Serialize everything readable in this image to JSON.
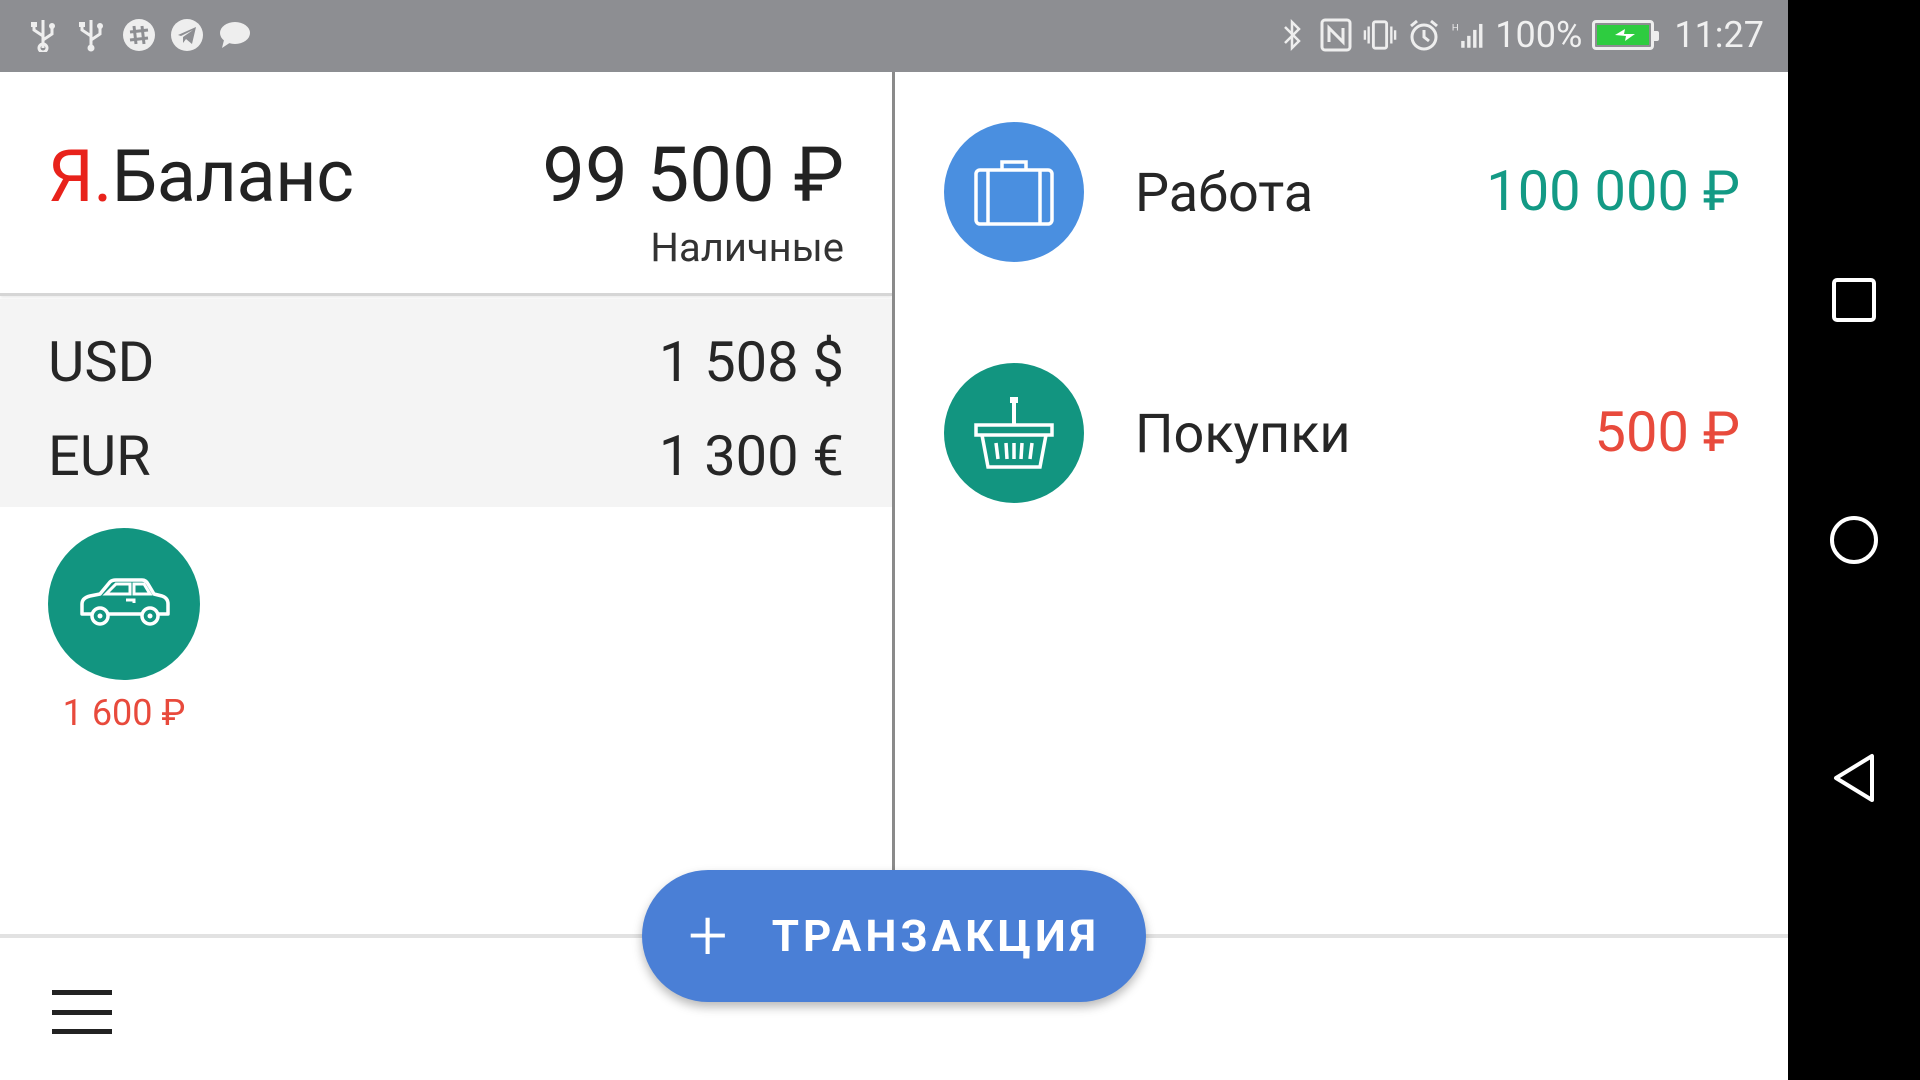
{
  "status_bar": {
    "left_icons": [
      "usb-icon",
      "usb-icon",
      "slack-icon",
      "telegram-icon",
      "chat-icon"
    ],
    "right_icons": [
      "bluetooth-icon",
      "nfc-icon",
      "vibrate-icon",
      "alarm-icon",
      "signal-icon"
    ],
    "battery_percent": "100%",
    "battery_level": 1.0,
    "time": "11:27"
  },
  "header": {
    "app_name_prefix": "Я.",
    "app_name_rest": "Баланс",
    "total": "99 500 ₽",
    "total_label": "Наличные"
  },
  "currencies": [
    {
      "code": "USD",
      "amount": "1 508 $"
    },
    {
      "code": "EUR",
      "amount": "1 300 €"
    }
  ],
  "accounts": [
    {
      "icon": "car-icon",
      "amount": "1 600 ₽",
      "color": "#129580"
    }
  ],
  "categories": [
    {
      "icon": "briefcase-icon",
      "name": "Работа",
      "amount": "100 000 ₽",
      "circle_color": "#4a8fe0",
      "amount_color": "#139a85"
    },
    {
      "icon": "basket-icon",
      "name": "Покупки",
      "amount": "500 ₽",
      "circle_color": "#129580",
      "amount_color": "#e84a3c"
    }
  ],
  "fab": {
    "plus": "+",
    "label": "ТРАНЗАКЦИЯ",
    "color": "#4a7fd6"
  },
  "bottom_bar": {
    "menu_icon": "hamburger-menu-icon"
  },
  "nav_bar": {
    "buttons": [
      "recents-icon",
      "home-icon",
      "back-icon"
    ]
  }
}
